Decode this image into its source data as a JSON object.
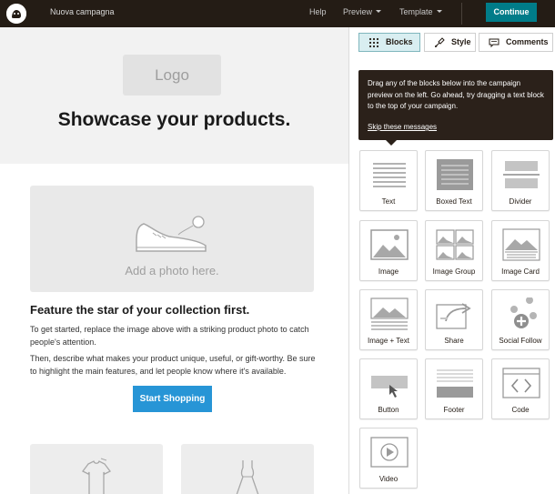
{
  "topbar": {
    "campaign_name": "Nuova campagna",
    "help": "Help",
    "preview": "Preview",
    "template": "Template",
    "continue": "Continue"
  },
  "preview": {
    "logo": "Logo",
    "title": "Showcase your products.",
    "photo_placeholder": "Add a photo here.",
    "feature_title": "Feature the star of your collection first.",
    "paragraph1": "To get started, replace the image above with a striking product photo to catch people's attention.",
    "paragraph2": "Then, describe what makes your product unique, useful, or gift-worthy. Be sure to highlight the main features, and let people know where it's available.",
    "button": "Start Shopping"
  },
  "panel": {
    "tabs": [
      {
        "label": "Blocks",
        "icon": "grid-icon"
      },
      {
        "label": "Style",
        "icon": "paint-brush-icon"
      },
      {
        "label": "Comments",
        "icon": "comment-icon"
      }
    ],
    "tooltip": {
      "text": "Drag any of the blocks below into the campaign preview on the left. Go ahead, try dragging a text block to the top of your campaign.",
      "skip": "Skip these messages"
    },
    "blocks": [
      "Text",
      "Boxed Text",
      "Divider",
      "Image",
      "Image Group",
      "Image Card",
      "Image + Text",
      "Share",
      "Social Follow",
      "Button",
      "Footer",
      "Code",
      "Video"
    ]
  },
  "colors": {
    "topbar": "#241c15",
    "accent": "#007c89",
    "button": "#2795d6"
  }
}
